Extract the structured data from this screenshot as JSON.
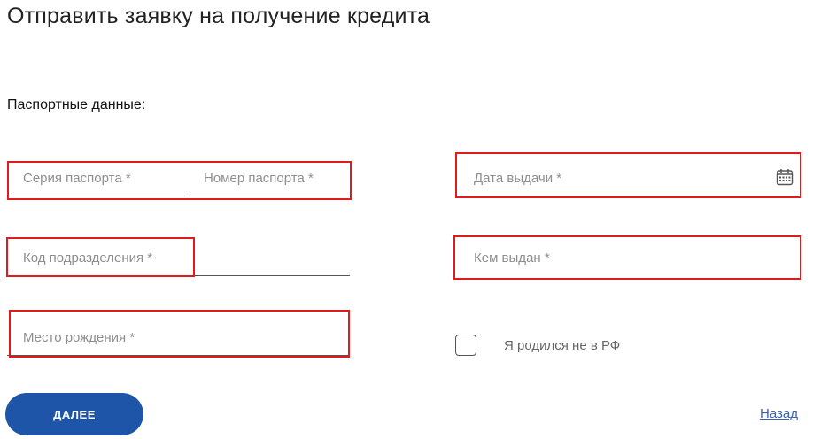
{
  "page": {
    "title": "Отправить заявку на получение кредита",
    "section_label": "Паспортные данные:"
  },
  "form": {
    "passport_series": {
      "placeholder": "Серия паспорта *",
      "value": ""
    },
    "passport_number": {
      "placeholder": "Номер паспорта *",
      "value": ""
    },
    "issue_date": {
      "placeholder": "Дата выдачи *",
      "value": ""
    },
    "division_code": {
      "placeholder": "Код подразделения *",
      "value": ""
    },
    "issued_by": {
      "placeholder": "Кем выдан *",
      "value": ""
    },
    "birth_place": {
      "placeholder": "Место рождения *",
      "value": ""
    },
    "born_outside_rf": {
      "label": "Я родился не в РФ",
      "checked": false
    }
  },
  "actions": {
    "next_label": "ДАЛЕЕ",
    "back_label": "Назад"
  },
  "icons": {
    "calendar": "calendar-icon"
  },
  "colors": {
    "primary_button": "#1f55a8",
    "link": "#3b62b5",
    "highlight": "#e01b1b"
  }
}
